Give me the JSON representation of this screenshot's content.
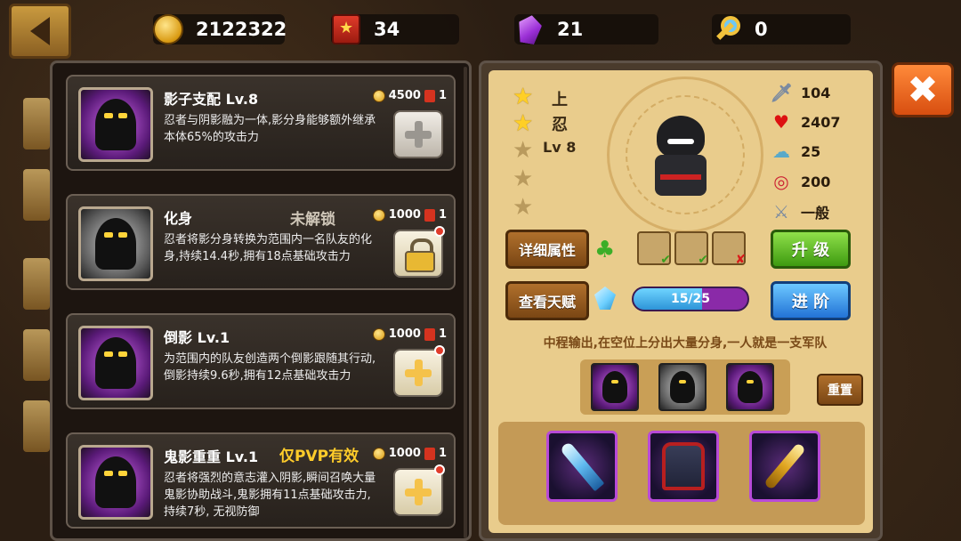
{
  "resources": {
    "gold": "2122322",
    "book": "34",
    "gem": "21",
    "key": "0"
  },
  "skills": [
    {
      "name": "影子支配 Lv.8",
      "tag": "",
      "cost_gold": "4500",
      "cost_book": "1",
      "desc": "忍者与阴影融为一体,影分身能够额外继承本体65%的攻击力",
      "action": "plus-gray",
      "locked": false
    },
    {
      "name": "化身",
      "tag": "未解锁",
      "cost_gold": "1000",
      "cost_book": "1",
      "desc": "忍者将影分身转换为范围内一名队友的化身,持续14.4秒,拥有18点基础攻击力",
      "action": "lock",
      "locked": true
    },
    {
      "name": "倒影 Lv.1",
      "tag": "",
      "cost_gold": "1000",
      "cost_book": "1",
      "desc": "为范围内的队友创造两个倒影跟随其行动,倒影持续9.6秒,拥有12点基础攻击力",
      "action": "plus-gold",
      "locked": false
    },
    {
      "name": "鬼影重重 Lv.1",
      "tag": "仅PVP有效",
      "cost_gold": "1000",
      "cost_book": "1",
      "desc": "忍者将强烈的意志灌入阴影,瞬间召唤大量鬼影协助战斗,鬼影拥有11点基础攻击力,持续7秒, 无视防御",
      "action": "plus-gold",
      "locked": false
    }
  ],
  "hero": {
    "rank1": "上",
    "rank2": "忍",
    "level": "Lv 8",
    "stars_filled": 2,
    "stars_total": 5,
    "stats": {
      "attack": "104",
      "hp": "2407",
      "speed": "25",
      "range": "200",
      "type": "一般"
    }
  },
  "buttons": {
    "details": "详细属性",
    "talent": "查看天赋",
    "upgrade": "升 级",
    "advance": "进 阶",
    "reset": "重置"
  },
  "progress": {
    "text": "15/25",
    "value": 15,
    "max": 25
  },
  "hero_description": "中程输出,在空位上分出大量分身,一人就是一支军队",
  "colors": {
    "accent_gold": "#ffcf26",
    "upgrade_green": "#3e9a10",
    "advance_blue": "#2272d6",
    "close_orange": "#d84e10"
  }
}
